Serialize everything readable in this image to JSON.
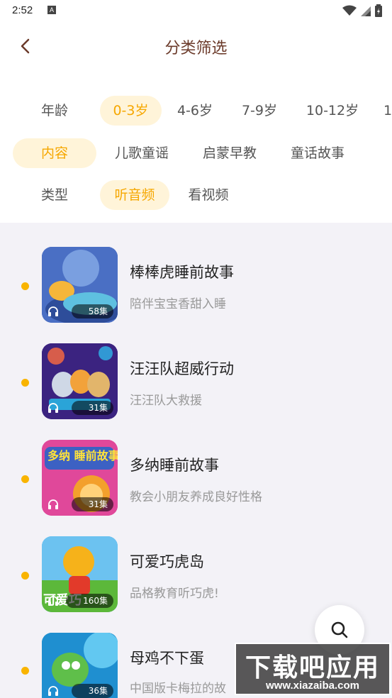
{
  "status_bar": {
    "time": "2:52",
    "notification_icon": "A"
  },
  "header": {
    "title": "分类筛选"
  },
  "filters": {
    "age": {
      "label": "年龄",
      "options": [
        "0-3岁",
        "4-6岁",
        "7-9岁",
        "10-12岁",
        "1"
      ],
      "selected": "0-3岁"
    },
    "content": {
      "label": "内容",
      "options": [
        "儿歌童谣",
        "启蒙早教",
        "童话故事"
      ]
    },
    "type": {
      "label": "类型",
      "options": [
        "听音频",
        "看视频"
      ],
      "selected": "听音频"
    }
  },
  "items": [
    {
      "title": "棒棒虎睡前故事",
      "subtitle": "陪伴宝宝香甜入睡",
      "episodes": "58集",
      "cover_color": "#3b5fb8"
    },
    {
      "title": "汪汪队超威行动",
      "subtitle": "汪汪队大救援",
      "episodes": "31集",
      "cover_color": "#4b2a8c"
    },
    {
      "title": "多纳睡前故事",
      "subtitle": "教会小朋友养成良好性格",
      "episodes": "31集",
      "cover_color": "#e0489a",
      "cover_text": "多纳 睡前故事"
    },
    {
      "title": "可爱巧虎岛",
      "subtitle": "品格教育听巧虎!",
      "episodes": "160集",
      "cover_color": "#5cb3e8",
      "cover_text": "可爱巧"
    },
    {
      "title": "母鸡不下蛋",
      "subtitle": "中国版卡梅拉的故",
      "episodes": "36集",
      "cover_color": "#1aa3c9"
    }
  ],
  "watermark": {
    "main": "下载吧应用",
    "url": "www.xiazaiba.com"
  },
  "colors": {
    "accent": "#f6a700",
    "pill_bg": "#fff4d9",
    "dot": "#f9b400",
    "title_brown": "#6b3a2a"
  }
}
